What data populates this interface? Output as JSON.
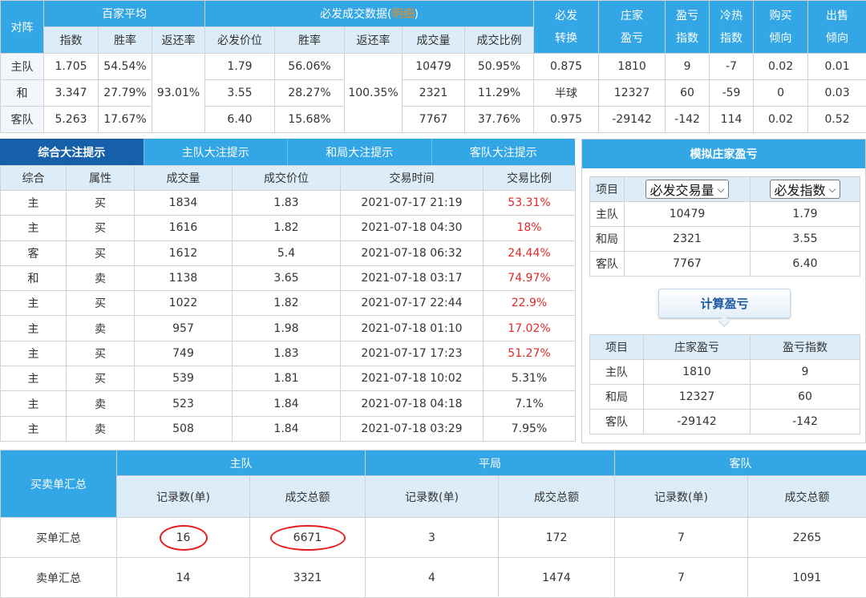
{
  "top": {
    "h_duizhen": "对阵",
    "h_baijia": "百家平均",
    "h_bifa": "必发成交数据(",
    "h_mingxi": "明细",
    "h_close": ")",
    "h_bifazhuanhuan": "必发\n转换",
    "h_zhuangjia": "庄家\n盈亏",
    "h_yingkui": "盈亏\n指数",
    "h_lengre": "冷热\n指数",
    "h_goumai": "购买\n倾向",
    "h_chushou": "出售\n倾向",
    "sub": [
      "指数",
      "胜率",
      "返还率",
      "必发价位",
      "胜率",
      "返还率",
      "成交量",
      "成交比例"
    ],
    "baijia_return": "93.01%",
    "bifa_return": "100.35%",
    "rows": [
      {
        "team": "主队",
        "idx": "1.705",
        "win": "54.54%",
        "price": "1.79",
        "bwin": "56.06%",
        "vol": "10479",
        "ratio": "50.95%",
        "conv": "0.875",
        "profit": "1810",
        "pidx": "9",
        "hot": "-7",
        "buy": "0.02",
        "sell": "0.01"
      },
      {
        "team": "和",
        "idx": "3.347",
        "win": "27.79%",
        "price": "3.55",
        "bwin": "28.27%",
        "vol": "2321",
        "ratio": "11.29%",
        "conv": "半球",
        "profit": "12327",
        "pidx": "60",
        "hot": "-59",
        "buy": "0",
        "sell": "0.03"
      },
      {
        "team": "客队",
        "idx": "5.263",
        "win": "17.67%",
        "price": "6.40",
        "bwin": "15.68%",
        "vol": "7767",
        "ratio": "37.76%",
        "conv": "0.975",
        "profit": "-29142",
        "pidx": "-142",
        "hot": "114",
        "buy": "0.02",
        "sell": "0.52"
      }
    ]
  },
  "tabs": [
    "综合大注提示",
    "主队大注提示",
    "和局大注提示",
    "客队大注提示"
  ],
  "bigbets": {
    "headers": [
      "综合",
      "属性",
      "成交量",
      "成交价位",
      "交易时间",
      "交易比例"
    ],
    "rows": [
      [
        "主",
        "买",
        "1834",
        "1.83",
        "2021-07-17 21:19",
        "53.31%"
      ],
      [
        "主",
        "买",
        "1616",
        "1.82",
        "2021-07-18 04:30",
        "18%"
      ],
      [
        "客",
        "买",
        "1612",
        "5.4",
        "2021-07-18 06:32",
        "24.44%"
      ],
      [
        "和",
        "卖",
        "1138",
        "3.65",
        "2021-07-18 03:17",
        "74.97%"
      ],
      [
        "主",
        "买",
        "1022",
        "1.82",
        "2021-07-17 22:44",
        "22.9%"
      ],
      [
        "主",
        "卖",
        "957",
        "1.98",
        "2021-07-18 01:10",
        "17.02%"
      ],
      [
        "主",
        "买",
        "749",
        "1.83",
        "2021-07-17 17:23",
        "51.27%"
      ],
      [
        "主",
        "买",
        "539",
        "1.81",
        "2021-07-18 10:02",
        "5.31%"
      ],
      [
        "主",
        "卖",
        "523",
        "1.84",
        "2021-07-18 04:18",
        "7.1%"
      ],
      [
        "主",
        "卖",
        "508",
        "1.84",
        "2021-07-18 03:29",
        "7.95%"
      ]
    ],
    "red_rows": 7
  },
  "sim": {
    "title": "模拟庄家盈亏",
    "t1_head": "项目",
    "select1": "必发交易量",
    "select2": "必发指数",
    "t1_rows": [
      [
        "主队",
        "10479",
        "1.79"
      ],
      [
        "和局",
        "2321",
        "3.55"
      ],
      [
        "客队",
        "7767",
        "6.40"
      ]
    ],
    "calc_btn": "计算盈亏",
    "t2_headers": [
      "项目",
      "庄家盈亏",
      "盈亏指数"
    ],
    "t2_rows": [
      [
        "主队",
        "1810",
        "9"
      ],
      [
        "和局",
        "12327",
        "60"
      ],
      [
        "客队",
        "-29142",
        "-142"
      ]
    ]
  },
  "summary": {
    "corner": "买卖单汇总",
    "groups": [
      "主队",
      "平局",
      "客队"
    ],
    "sub": [
      "记录数(单)",
      "成交总额",
      "记录数(单)",
      "成交总额",
      "记录数(单)",
      "成交总额"
    ],
    "rows": [
      {
        "label": "买单汇总",
        "cells": [
          "16",
          "6671",
          "3",
          "172",
          "7",
          "2265"
        ]
      },
      {
        "label": "卖单汇总",
        "cells": [
          "14",
          "3321",
          "4",
          "1474",
          "7",
          "1091"
        ]
      }
    ]
  },
  "colors": {
    "header_blue": "#33a6e6",
    "active_tab": "#1660aa",
    "red": "#e02a2a",
    "light": "#dcedf9",
    "highlight_circle": "#e51d1d"
  }
}
